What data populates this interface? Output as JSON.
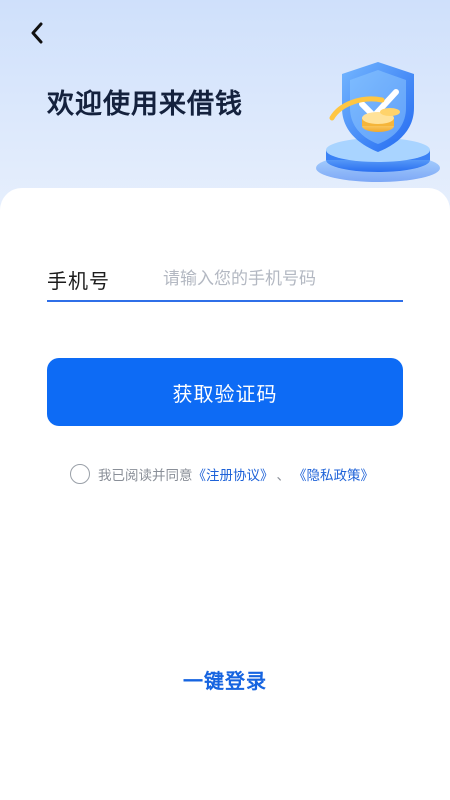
{
  "header": {
    "back_icon": "chevron-left-icon",
    "title": "欢迎使用来借钱",
    "illustration": "shield-coins-illustration"
  },
  "form": {
    "phone_label": "手机号",
    "phone_placeholder": "请输入您的手机号码",
    "phone_value": "",
    "get_code_label": "获取验证码"
  },
  "agreement": {
    "checked": false,
    "prefix": "我已阅读并同意",
    "register_link": "《注册协议》",
    "separator": "、",
    "privacy_link": "《隐私政策》"
  },
  "footer": {
    "one_click_login": "一键登录"
  },
  "colors": {
    "primary": "#0d6bf5",
    "link": "#1e62d8",
    "header_bg": "#d6e5fc"
  }
}
